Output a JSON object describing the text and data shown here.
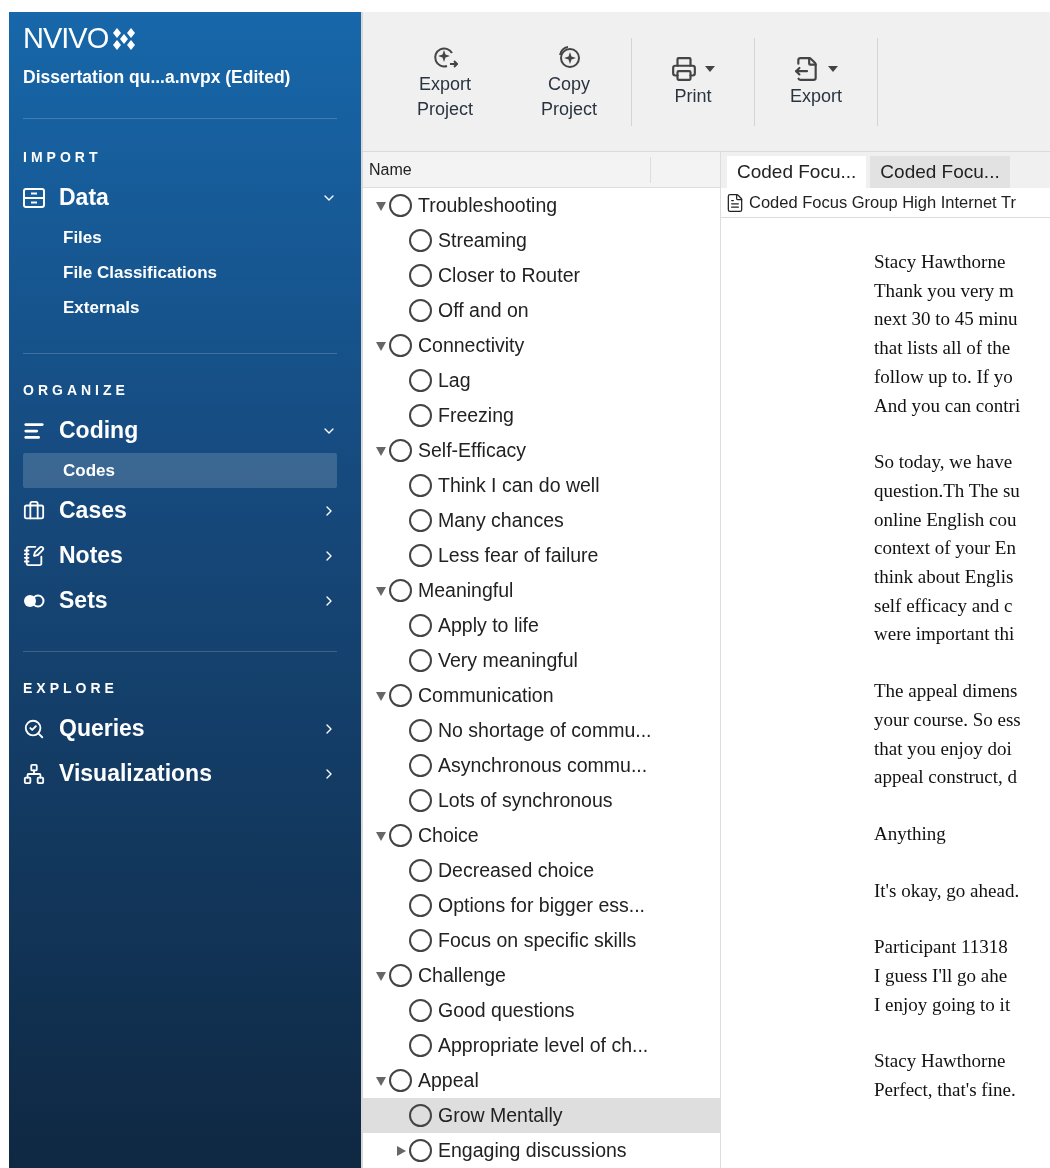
{
  "app": {
    "logo": "NVIVO",
    "project_title": "Dissertation qu...a.nvpx (Edited)"
  },
  "sidebar": {
    "sections": [
      {
        "heading": "IMPORT",
        "items": [
          {
            "label": "Data",
            "expanded": true,
            "children": [
              {
                "label": "Files",
                "selected": false
              },
              {
                "label": "File Classifications",
                "selected": false
              },
              {
                "label": "Externals",
                "selected": false
              }
            ]
          }
        ]
      },
      {
        "heading": "ORGANIZE",
        "items": [
          {
            "label": "Coding",
            "expanded": true,
            "children": [
              {
                "label": "Codes",
                "selected": true
              }
            ]
          },
          {
            "label": "Cases",
            "expanded": false
          },
          {
            "label": "Notes",
            "expanded": false
          },
          {
            "label": "Sets",
            "expanded": false
          }
        ]
      },
      {
        "heading": "EXPLORE",
        "items": [
          {
            "label": "Queries",
            "expanded": false
          },
          {
            "label": "Visualizations",
            "expanded": false
          }
        ]
      }
    ]
  },
  "toolbar": [
    {
      "label": "Export Project",
      "dropdown": false
    },
    {
      "label": "Copy Project",
      "dropdown": false
    },
    {
      "label": "Print",
      "dropdown": true
    },
    {
      "label": "Export",
      "dropdown": true
    }
  ],
  "codes": {
    "column": "Name",
    "tree": [
      {
        "name": "Troubleshooting",
        "expanded": true,
        "selected": false,
        "children": [
          {
            "name": "Streaming",
            "selected": false
          },
          {
            "name": "Closer to Router",
            "selected": false
          },
          {
            "name": "Off and on",
            "selected": false
          }
        ]
      },
      {
        "name": "Connectivity",
        "expanded": true,
        "selected": false,
        "children": [
          {
            "name": "Lag",
            "selected": false
          },
          {
            "name": "Freezing",
            "selected": false
          }
        ]
      },
      {
        "name": "Self-Efficacy",
        "expanded": true,
        "selected": false,
        "children": [
          {
            "name": "Think I can do well",
            "selected": false
          },
          {
            "name": "Many chances",
            "selected": false
          },
          {
            "name": "Less fear of failure",
            "selected": false
          }
        ]
      },
      {
        "name": "Meaningful",
        "expanded": true,
        "selected": false,
        "children": [
          {
            "name": "Apply to life",
            "selected": false
          },
          {
            "name": "Very meaningful",
            "selected": false
          }
        ]
      },
      {
        "name": "Communication",
        "expanded": true,
        "selected": false,
        "children": [
          {
            "name": "No shortage of commu...",
            "selected": false
          },
          {
            "name": "Asynchronous commu...",
            "selected": false
          },
          {
            "name": "Lots of synchronous",
            "selected": false
          }
        ]
      },
      {
        "name": "Choice",
        "expanded": true,
        "selected": false,
        "children": [
          {
            "name": "Decreased choice",
            "selected": false
          },
          {
            "name": "Options for bigger ess...",
            "selected": false
          },
          {
            "name": "Focus on specific skills",
            "selected": false
          }
        ]
      },
      {
        "name": "Challenge",
        "expanded": true,
        "selected": false,
        "children": [
          {
            "name": "Good questions",
            "selected": false
          },
          {
            "name": "Appropriate level of ch...",
            "selected": false
          }
        ]
      },
      {
        "name": "Appeal",
        "expanded": true,
        "selected": false,
        "children": [
          {
            "name": "Grow Mentally",
            "selected": true
          },
          {
            "name": "Engaging discussions",
            "selected": false,
            "expanded": false
          }
        ]
      }
    ]
  },
  "document": {
    "tabs": [
      {
        "label": "Coded Focu...",
        "selected": true
      },
      {
        "label": "Coded Focu...",
        "selected": false
      }
    ],
    "path": "Coded Focus Group High Internet Tr",
    "paragraphs": [
      [
        "Stacy Hawthorne",
        "Thank you very m",
        "next 30 to 45 minu",
        "that lists all of the",
        "follow up to. If yo",
        "And you can contri"
      ],
      [
        "So today, we have",
        "question.Th The su",
        "online English cou",
        "context of your En",
        "think about Englis",
        "self efficacy and c",
        "were important thi"
      ],
      [
        "The appeal dimens",
        "your course. So ess",
        "that you enjoy doi",
        "appeal construct, d"
      ],
      [
        "Anything"
      ],
      [
        "It's okay, go ahead."
      ],
      [
        "Participant 11318",
        "I guess I'll go ahe",
        "I enjoy going to it"
      ],
      [
        "Stacy Hawthorne",
        "Perfect, that's fine."
      ]
    ]
  }
}
